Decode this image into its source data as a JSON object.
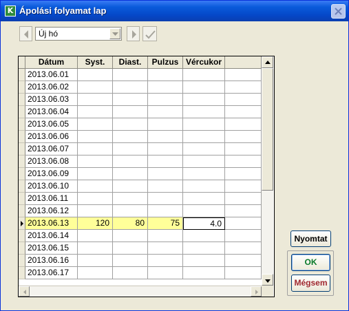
{
  "window": {
    "title": "Ápolási folyamat lap"
  },
  "toolbar": {
    "month_value": "Új hó"
  },
  "table": {
    "columns": [
      "Dátum",
      "Syst.",
      "Diast.",
      "Pulzus",
      "Vércukor"
    ],
    "rows": [
      {
        "date": "2013.06.01",
        "syst": "",
        "diast": "",
        "pulse": "",
        "sugar": ""
      },
      {
        "date": "2013.06.02",
        "syst": "",
        "diast": "",
        "pulse": "",
        "sugar": ""
      },
      {
        "date": "2013.06.03",
        "syst": "",
        "diast": "",
        "pulse": "",
        "sugar": ""
      },
      {
        "date": "2013.06.04",
        "syst": "",
        "diast": "",
        "pulse": "",
        "sugar": ""
      },
      {
        "date": "2013.06.05",
        "syst": "",
        "diast": "",
        "pulse": "",
        "sugar": ""
      },
      {
        "date": "2013.06.06",
        "syst": "",
        "diast": "",
        "pulse": "",
        "sugar": ""
      },
      {
        "date": "2013.06.07",
        "syst": "",
        "diast": "",
        "pulse": "",
        "sugar": ""
      },
      {
        "date": "2013.06.08",
        "syst": "",
        "diast": "",
        "pulse": "",
        "sugar": ""
      },
      {
        "date": "2013.06.09",
        "syst": "",
        "diast": "",
        "pulse": "",
        "sugar": ""
      },
      {
        "date": "2013.06.10",
        "syst": "",
        "diast": "",
        "pulse": "",
        "sugar": ""
      },
      {
        "date": "2013.06.11",
        "syst": "",
        "diast": "",
        "pulse": "",
        "sugar": ""
      },
      {
        "date": "2013.06.12",
        "syst": "",
        "diast": "",
        "pulse": "",
        "sugar": ""
      },
      {
        "date": "2013.06.13",
        "syst": "120",
        "diast": "80",
        "pulse": "75",
        "sugar": "4.0",
        "selected": true
      },
      {
        "date": "2013.06.14",
        "syst": "",
        "diast": "",
        "pulse": "",
        "sugar": ""
      },
      {
        "date": "2013.06.15",
        "syst": "",
        "diast": "",
        "pulse": "",
        "sugar": ""
      },
      {
        "date": "2013.06.16",
        "syst": "",
        "diast": "",
        "pulse": "",
        "sugar": ""
      },
      {
        "date": "2013.06.17",
        "syst": "",
        "diast": "",
        "pulse": "",
        "sugar": ""
      }
    ]
  },
  "buttons": {
    "print": "Nyomtat",
    "ok": "OK",
    "cancel": "Mégsem"
  },
  "icons": {
    "app": "app-icon",
    "close": "close-icon",
    "prev": "arrow-left-icon",
    "dropdown": "chevron-down-icon",
    "next": "arrow-right-icon",
    "confirm": "checkmark-icon",
    "row_indicator": "current-row-arrow-icon"
  },
  "colors": {
    "titlebar": "#0a5bdb",
    "highlight_row": "#ffff99",
    "ok_text": "#0a7a2a",
    "cancel_text": "#a0282f"
  }
}
